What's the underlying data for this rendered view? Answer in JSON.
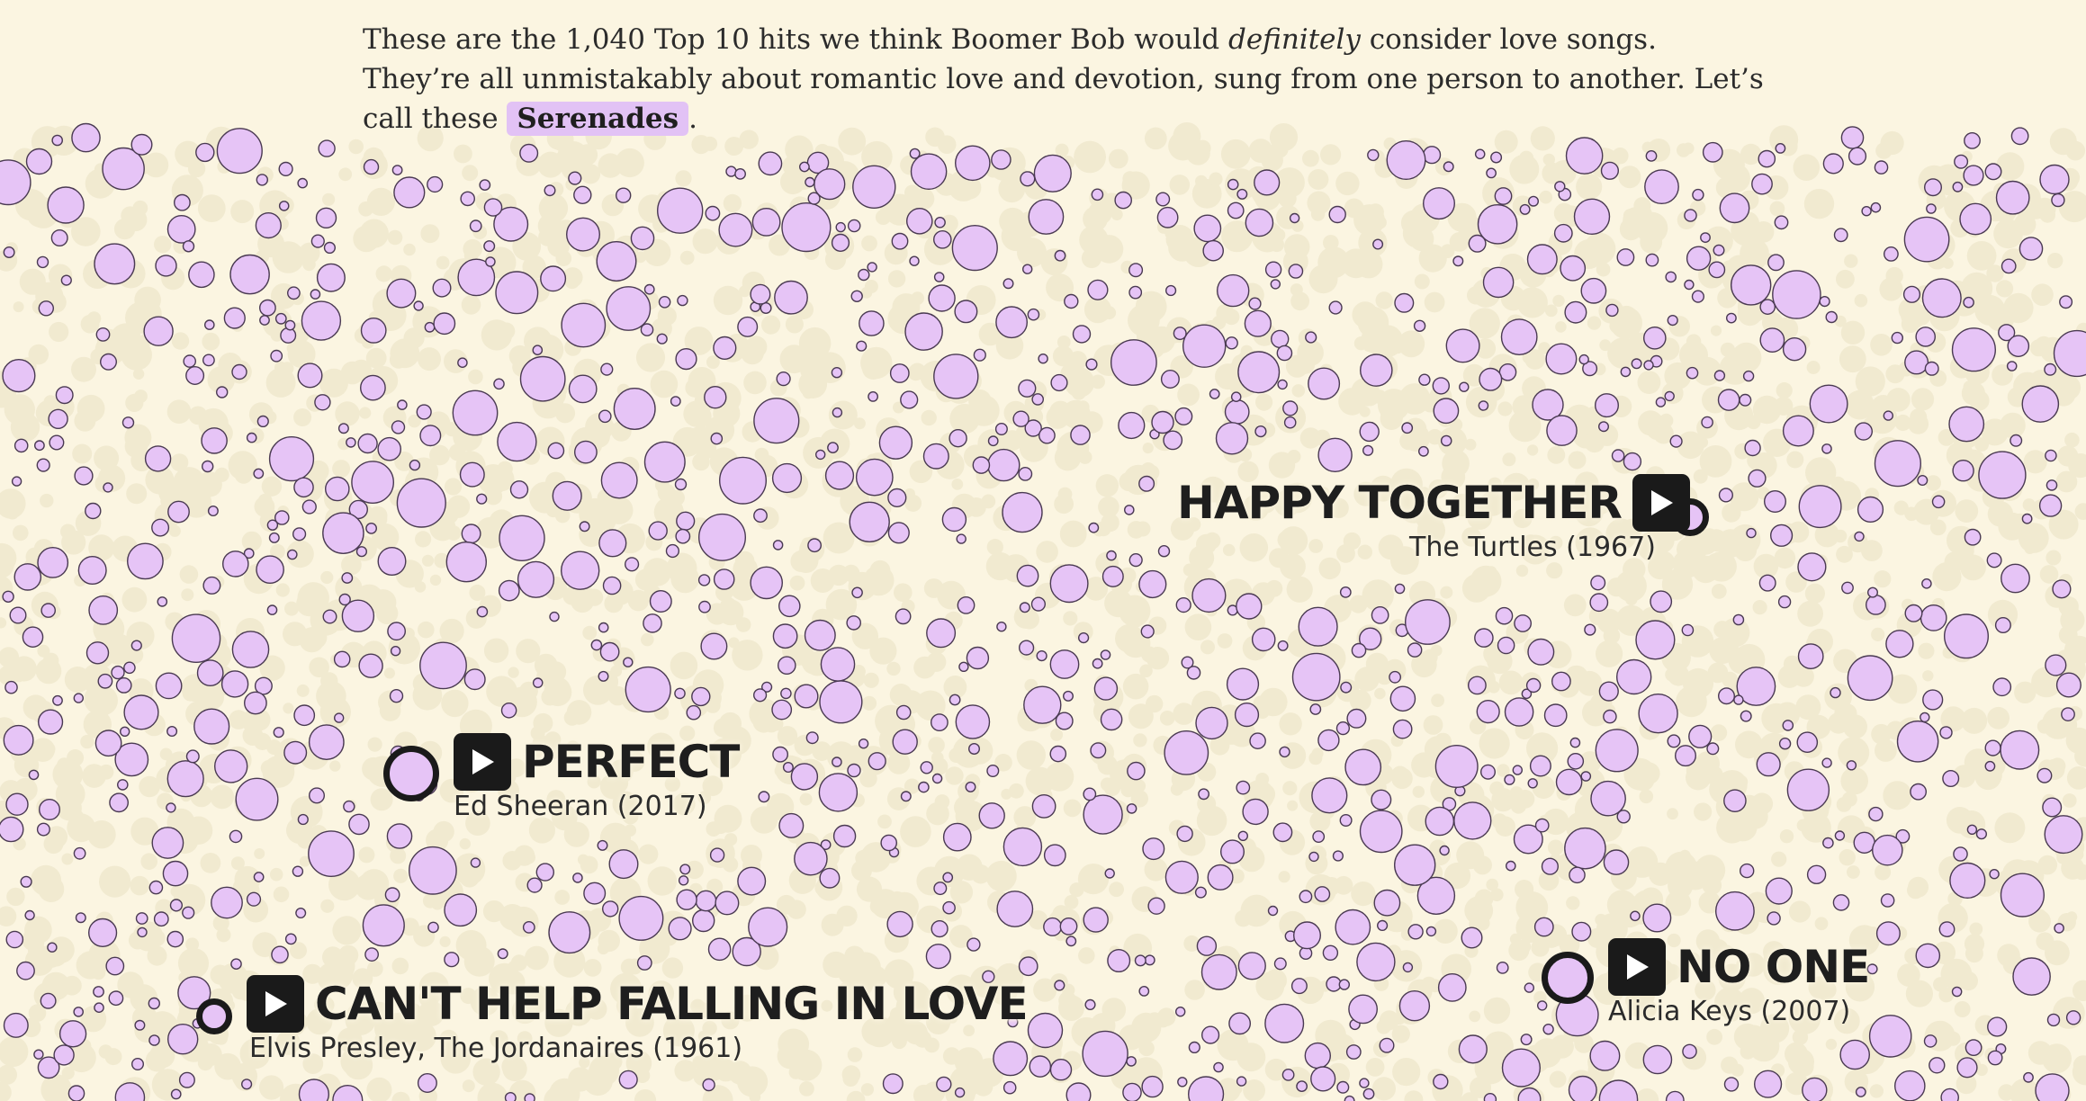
{
  "intro": {
    "part1": "These are the 1,040 Top 10 hits we think Boomer Bob would ",
    "emphasis": "definitely",
    "part2": " consider love songs. They’re all unmistakably about romantic love and devotion, sung from one person to another. Let’s call these ",
    "chip": "Serenades",
    "end": "."
  },
  "colors": {
    "background": "#fbf5e1",
    "bubble_fill": "#e6c4f6",
    "bubble_stroke": "#4a3a52",
    "ghost_bubble": "#f1ead0",
    "chip": "#e2c2f5",
    "play_button": "#1a1a1a"
  },
  "songs": [
    {
      "title": "HAPPY TOGETHER",
      "artist": "The Turtles (1967)",
      "icon": "play-icon"
    },
    {
      "title": "PERFECT",
      "artist": "Ed Sheeran (2017)",
      "icon": "play-icon"
    },
    {
      "title": "NO ONE",
      "artist": "Alicia Keys (2007)",
      "icon": "play-icon"
    },
    {
      "title": "CAN'T HELP FALLING IN LOVE",
      "artist": "Elvis Presley, The Jordanaires (1961)",
      "icon": "play-icon"
    }
  ]
}
